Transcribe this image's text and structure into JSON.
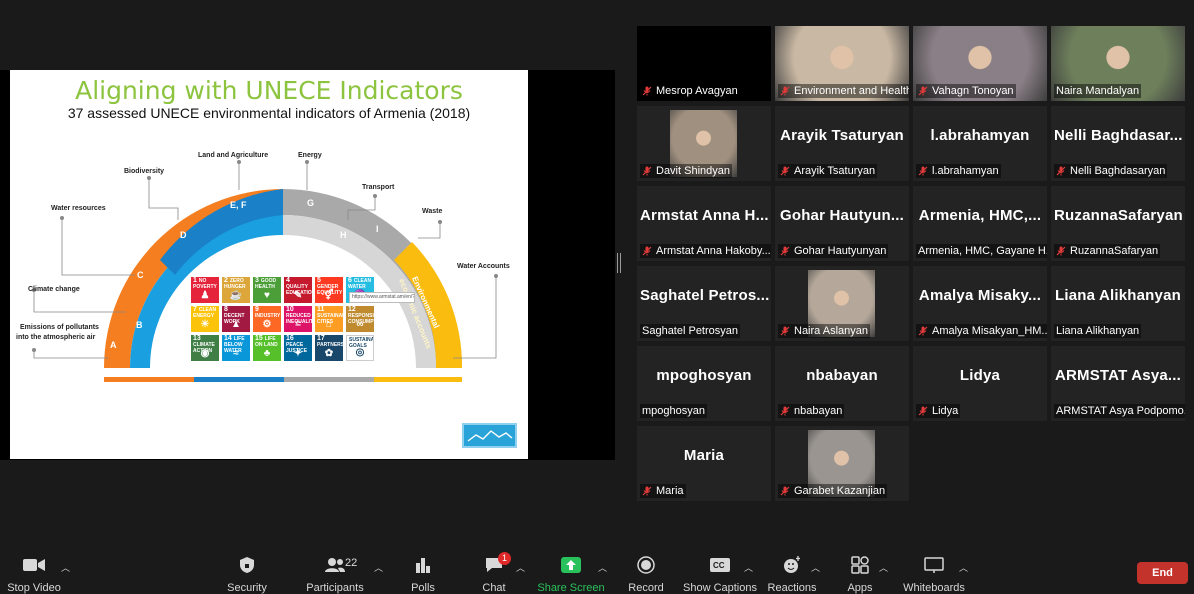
{
  "slide": {
    "title": "Aligning with UNECE Indicators",
    "subtitle": "37 assessed UNECE environmental indicators of Armenia (2018)",
    "outer_labels": {
      "land": "Land and Agriculture",
      "energy": "Energy",
      "biodiversity": "Biodiversity",
      "transport": "Transport",
      "water_resources": "Water resources",
      "waste": "Waste",
      "water_accounts": "Water Accounts",
      "climate": "Climate change",
      "emissions_1": "Emissions of pollutants",
      "emissions_2": "into the atmospheric air"
    },
    "arc_letters": {
      "a": "A",
      "b": "B",
      "c": "C",
      "d": "D",
      "ef": "E, F",
      "g": "G",
      "h": "H",
      "i": "I"
    },
    "env_accounts_1": "Environmental",
    "env_accounts_2": "economic accounts",
    "sdg_url": "https://www.armstat.am/en/?nid=433",
    "sdg_tiles": [
      {
        "num": "1",
        "label": "NO POVERTY",
        "color": "#e5243b",
        "glyph": "♟"
      },
      {
        "num": "2",
        "label": "ZERO HUNGER",
        "color": "#dda63a",
        "glyph": "☕"
      },
      {
        "num": "3",
        "label": "GOOD HEALTH",
        "color": "#4c9f38",
        "glyph": "♥"
      },
      {
        "num": "4",
        "label": "QUALITY EDUCATION",
        "color": "#c5192d",
        "glyph": "✎"
      },
      {
        "num": "5",
        "label": "GENDER EQUALITY",
        "color": "#ff3a21",
        "glyph": "⚥"
      },
      {
        "num": "6",
        "label": "CLEAN WATER",
        "color": "#26bde2",
        "glyph": "♒"
      },
      {
        "num": "7",
        "label": "CLEAN ENERGY",
        "color": "#fcc30b",
        "glyph": "☀"
      },
      {
        "num": "8",
        "label": "DECENT WORK",
        "color": "#a21942",
        "glyph": "▲"
      },
      {
        "num": "9",
        "label": "INDUSTRY",
        "color": "#fd6925",
        "glyph": "⚙"
      },
      {
        "num": "10",
        "label": "REDUCED INEQUALITIES",
        "color": "#dd1367",
        "glyph": "="
      },
      {
        "num": "11",
        "label": "SUSTAINABLE CITIES",
        "color": "#fd9d24",
        "glyph": "⌂"
      },
      {
        "num": "12",
        "label": "RESPONSIBLE CONSUMPTION",
        "color": "#bf8b2e",
        "glyph": "∞"
      },
      {
        "num": "13",
        "label": "CLIMATE ACTION",
        "color": "#3f7e44",
        "glyph": "◉"
      },
      {
        "num": "14",
        "label": "LIFE BELOW WATER",
        "color": "#0a97d9",
        "glyph": "≈"
      },
      {
        "num": "15",
        "label": "LIFE ON LAND",
        "color": "#56c02b",
        "glyph": "♣"
      },
      {
        "num": "16",
        "label": "PEACE JUSTICE",
        "color": "#00689d",
        "glyph": "✦"
      },
      {
        "num": "17",
        "label": "PARTNERSHIPS",
        "color": "#19486a",
        "glyph": "✿"
      },
      {
        "num": "",
        "label": "SUSTAINABLE GOALS",
        "color": "#ffffff",
        "glyph": "◎"
      }
    ]
  },
  "participants": [
    {
      "label": "Mesrop Avagyan",
      "big": "",
      "muted": true,
      "video": "black"
    },
    {
      "label": "Environment and Health",
      "big": "",
      "muted": true,
      "video": "cam",
      "cam_color": "#c9b8a3"
    },
    {
      "label": "Vahagn Tonoyan",
      "big": "",
      "muted": true,
      "video": "cam",
      "cam_color": "#8a7f86"
    },
    {
      "label": "Naira Mandalyan",
      "big": "",
      "muted": false,
      "video": "cam",
      "cam_color": "#6d7f5b",
      "speaking": true
    },
    {
      "label": "Davit Shindyan",
      "big": "",
      "muted": true,
      "video": "photo",
      "cam_color": "#a0907f"
    },
    {
      "label": "Arayik Tsaturyan",
      "big": "Arayik Tsaturyan",
      "muted": true,
      "video": "none"
    },
    {
      "label": "l.abrahamyan",
      "big": "l.abrahamyan",
      "muted": true,
      "video": "none"
    },
    {
      "label": "Nelli Baghdasaryan",
      "big": "Nelli Baghdasar...",
      "muted": true,
      "video": "none"
    },
    {
      "label": "Armstat Anna Hakoby...",
      "big": "Armstat Anna H...",
      "muted": true,
      "video": "none"
    },
    {
      "label": "Gohar Hautyunyan",
      "big": "Gohar Hautyun...",
      "muted": true,
      "video": "none"
    },
    {
      "label": "Armenia, HMC, Gayane H...",
      "big": "Armenia, HMC,...",
      "muted": false,
      "video": "none"
    },
    {
      "label": "RuzannaSafaryan",
      "big": "RuzannaSafaryan",
      "muted": true,
      "video": "none"
    },
    {
      "label": "Saghatel Petrosyan",
      "big": "Saghatel Petros...",
      "muted": false,
      "video": "none"
    },
    {
      "label": "Naira Aslanyan",
      "big": "",
      "muted": true,
      "video": "photo",
      "cam_color": "#b5a89a"
    },
    {
      "label": "Amalya Misakyan_HM...",
      "big": "Amalya Misaky...",
      "muted": true,
      "video": "none"
    },
    {
      "label": "Liana Alikhanyan",
      "big": "Liana Alikhanyan",
      "muted": false,
      "video": "none"
    },
    {
      "label": "mpoghosyan",
      "big": "mpoghosyan",
      "muted": false,
      "video": "none"
    },
    {
      "label": "nbabayan",
      "big": "nbabayan",
      "muted": true,
      "video": "none"
    },
    {
      "label": "Lidya",
      "big": "Lidya",
      "muted": true,
      "video": "none"
    },
    {
      "label": "ARMSTAT Asya Podpomo...",
      "big": "ARMSTAT Asya...",
      "muted": false,
      "video": "none"
    },
    {
      "label": "Maria",
      "big": "Maria",
      "muted": true,
      "video": "none"
    },
    {
      "label": "Garabet Kazanjian",
      "big": "",
      "muted": true,
      "video": "photo",
      "cam_color": "#9a9590"
    }
  ],
  "toolbar": {
    "stop_video": "Stop Video",
    "security": "Security",
    "participants": "Participants",
    "participants_count": "22",
    "polls": "Polls",
    "chat": "Chat",
    "chat_badge": "1",
    "share_screen": "Share Screen",
    "record": "Record",
    "show_captions": "Show Captions",
    "reactions": "Reactions",
    "apps": "Apps",
    "whiteboards": "Whiteboards",
    "end": "End",
    "accent_green": "#29c15b",
    "end_red": "#c4322c"
  }
}
